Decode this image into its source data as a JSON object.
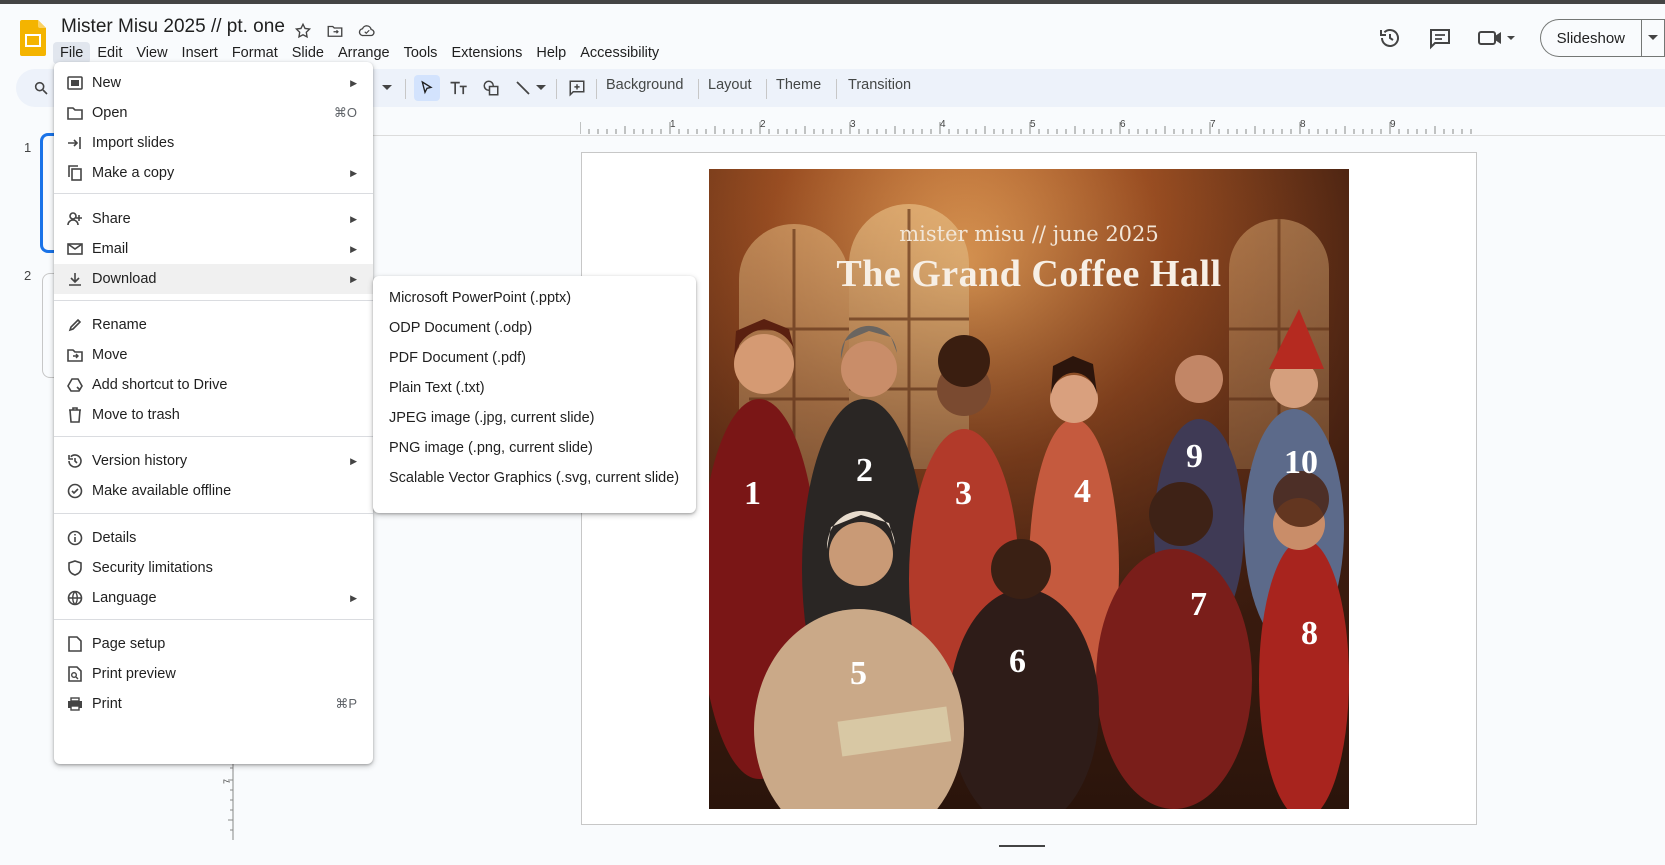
{
  "header": {
    "doc_title": "Mister Misu 2025 // pt. one",
    "menus": [
      "File",
      "Edit",
      "View",
      "Insert",
      "Format",
      "Slide",
      "Arrange",
      "Tools",
      "Extensions",
      "Help",
      "Accessibility"
    ],
    "slideshow_label": "Slideshow"
  },
  "toolbar": {
    "background_label": "Background",
    "layout_label": "Layout",
    "theme_label": "Theme",
    "transition_label": "Transition"
  },
  "ruler": {
    "h_ticks": [
      "1",
      "2",
      "3",
      "4",
      "5",
      "6",
      "7",
      "8",
      "9"
    ],
    "v_tick": "7"
  },
  "thumbnails": [
    "1",
    "2"
  ],
  "slide": {
    "subtitle": "mister misu // june 2025",
    "title": "The Grand Coffee Hall",
    "numbers": [
      "1",
      "2",
      "3",
      "4",
      "9",
      "10",
      "5",
      "6",
      "7",
      "8"
    ]
  },
  "file_menu": {
    "new": "New",
    "open": "Open",
    "open_shortcut": "⌘O",
    "import_slides": "Import slides",
    "make_copy": "Make a copy",
    "share": "Share",
    "email": "Email",
    "download": "Download",
    "rename": "Rename",
    "move": "Move",
    "add_shortcut": "Add shortcut to Drive",
    "move_trash": "Move to trash",
    "version_history": "Version history",
    "offline": "Make available offline",
    "details": "Details",
    "security": "Security limitations",
    "language": "Language",
    "page_setup": "Page setup",
    "print_preview": "Print preview",
    "print": "Print",
    "print_shortcut": "⌘P"
  },
  "download_menu": {
    "pptx": "Microsoft PowerPoint (.pptx)",
    "odp": "ODP Document (.odp)",
    "pdf": "PDF Document (.pdf)",
    "txt": "Plain Text (.txt)",
    "jpg": "JPEG image (.jpg, current slide)",
    "png": "PNG image (.png, current slide)",
    "svg": "Scalable Vector Graphics (.svg, current slide)"
  },
  "colors": {
    "accent": "#1a73e8",
    "toolbar_bg": "#edf2fa",
    "logo": "#f4b400"
  }
}
